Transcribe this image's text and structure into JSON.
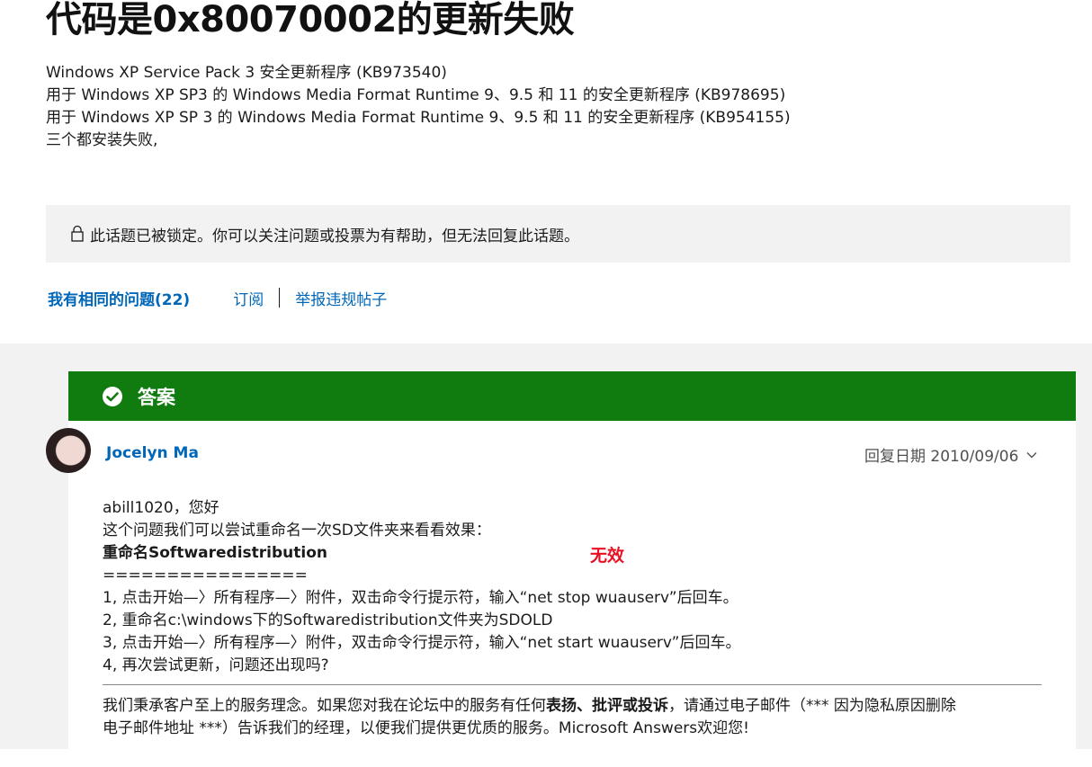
{
  "page": {
    "title": "代码是0x80070002的更新失败"
  },
  "question": {
    "lines": [
      "Windows XP Service Pack 3 安全更新程序 (KB973540)",
      "用于 Windows XP SP3 的 Windows Media Format Runtime 9、9.5 和 11 的安全更新程序 (KB978695)",
      "用于 Windows XP SP 3 的 Windows Media Format Runtime 9、9.5 和 11 的安全更新程序 (KB954155)",
      "三个都安装失败,"
    ]
  },
  "locked_notice": {
    "icon": "lock-icon",
    "text": "此话题已被锁定。你可以关注问题或投票为有帮助，但无法回复此话题。"
  },
  "actions": {
    "same_question": "我有相同的问题(22)",
    "subscribe": "订阅",
    "report": "举报违规帖子"
  },
  "answer": {
    "header_label": "答案",
    "header_icon": "checkmark-circle-icon",
    "author": "Jocelyn Ma",
    "reply_date": "回复日期 2010/09/06",
    "body": {
      "greeting": "abill1020，您好",
      "intro": "这个问题我们可以尝试重命名一次SD文件夹来看看效果：",
      "heading": "重命名Softwaredistribution",
      "separator": "================",
      "step1": "1, 点击开始—〉所有程序—〉附件，双击命令行提示符，输入“net stop wuauserv”后回车。",
      "step2": "2, 重命名c:\\windows下的Softwaredistribution文件夹为SDOLD",
      "step3": "3, 点击开始—〉所有程序—〉附件，双击命令行提示符，输入“net start wuauserv”后回车。",
      "step4": "4, 再次尝试更新，问题还出现吗?"
    },
    "annotation": "无效",
    "footer": {
      "part1": "我们秉承客户至上的服务理念。如果您对我在论坛中的服务有任何",
      "bold": "表扬、批评或投诉",
      "part2": "，请通过电子邮件（*** 因为隐私原因删除",
      "line2": "电子邮件地址 ***）告诉我们的经理，以便我们提供更优质的服务。Microsoft Answers欢迎您!"
    }
  },
  "colors": {
    "accent_link": "#0067b8",
    "answer_green": "#107c10",
    "annotation_red": "#e81123",
    "panel_gray": "#f2f2f2"
  }
}
